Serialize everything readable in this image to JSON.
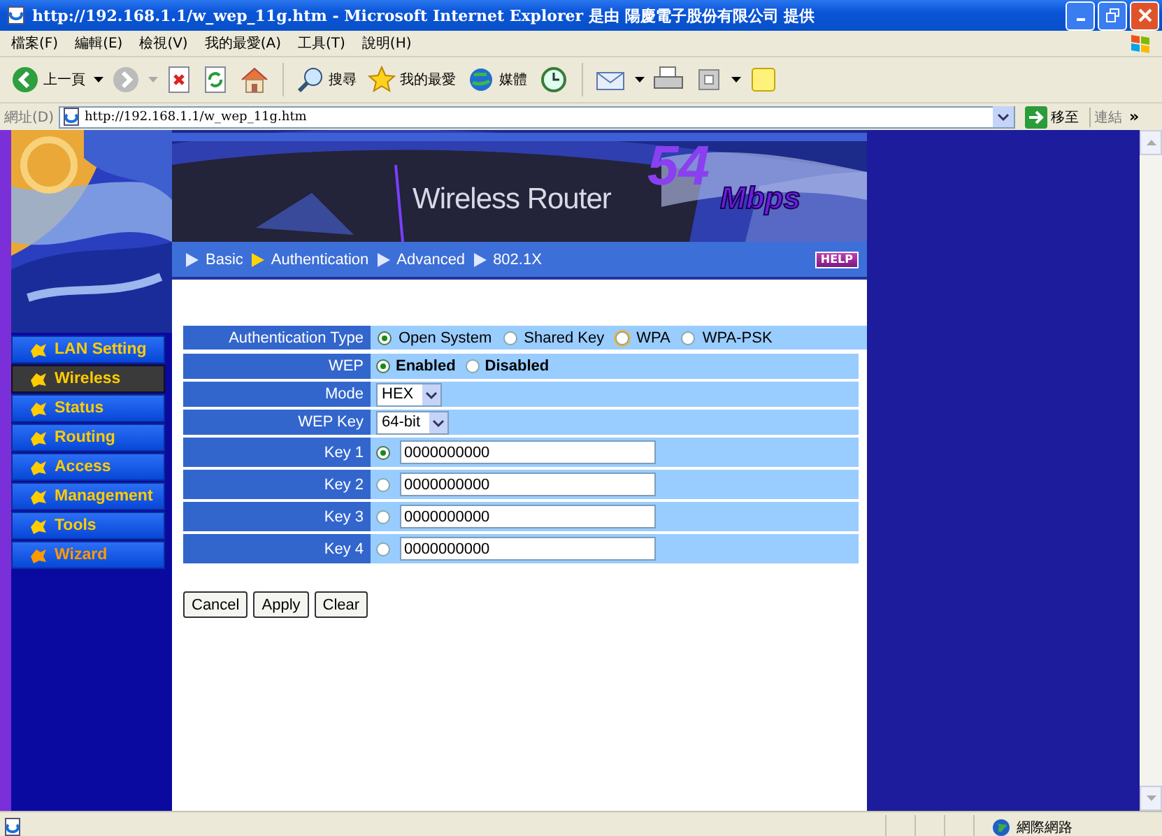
{
  "window": {
    "title": "http://192.168.1.1/w_wep_11g.htm - Microsoft Internet Explorer 是由 陽慶電子股份有限公司 提供"
  },
  "menu": [
    "檔案(F)",
    "編輯(E)",
    "檢視(V)",
    "我的最愛(A)",
    "工具(T)",
    "說明(H)"
  ],
  "toolbar": {
    "back": "上一頁",
    "search": "搜尋",
    "favorites": "我的最愛",
    "media": "媒體"
  },
  "address": {
    "label": "網址(D)",
    "value": "http://192.168.1.1/w_wep_11g.htm",
    "go": "移至",
    "links": "連結",
    "more": "»"
  },
  "sidebar": {
    "items": [
      {
        "label": "LAN Setting",
        "selected": false,
        "color": "#ffcc00"
      },
      {
        "label": "Wireless",
        "selected": true,
        "color": "#ffcc00"
      },
      {
        "label": "Status",
        "selected": false,
        "color": "#ffcc00"
      },
      {
        "label": "Routing",
        "selected": false,
        "color": "#ffcc00"
      },
      {
        "label": "Access",
        "selected": false,
        "color": "#ffcc00"
      },
      {
        "label": "Management",
        "selected": false,
        "color": "#ffcc00"
      },
      {
        "label": "Tools",
        "selected": false,
        "color": "#ffcc00"
      },
      {
        "label": "Wizard",
        "selected": false,
        "color": "#ff9900"
      }
    ]
  },
  "banner": {
    "title": "Wireless Router",
    "speed": "54",
    "unit": "Mbps"
  },
  "tabs": [
    {
      "label": "Basic",
      "selected": false
    },
    {
      "label": "Authentication",
      "selected": true
    },
    {
      "label": "Advanced",
      "selected": false
    },
    {
      "label": "802.1X",
      "selected": false
    }
  ],
  "help": "HELP",
  "form": {
    "auth_type": {
      "label": "Authentication Type",
      "options": [
        {
          "label": "Open System",
          "selected": true,
          "highlighted": false
        },
        {
          "label": "Shared Key",
          "selected": false,
          "highlighted": false
        },
        {
          "label": "WPA",
          "selected": false,
          "highlighted": true
        },
        {
          "label": "WPA-PSK",
          "selected": false,
          "highlighted": false
        }
      ]
    },
    "wep": {
      "label": "WEP",
      "options": [
        {
          "label": "Enabled",
          "selected": true
        },
        {
          "label": "Disabled",
          "selected": false
        }
      ]
    },
    "mode": {
      "label": "Mode",
      "value": "HEX"
    },
    "wep_key": {
      "label": "WEP Key",
      "value": "64-bit"
    },
    "keys": [
      {
        "label": "Key 1",
        "selected": true,
        "value": "0000000000"
      },
      {
        "label": "Key 2",
        "selected": false,
        "value": "0000000000"
      },
      {
        "label": "Key 3",
        "selected": false,
        "value": "0000000000"
      },
      {
        "label": "Key 4",
        "selected": false,
        "value": "0000000000"
      }
    ]
  },
  "buttons": [
    "Cancel",
    "Apply",
    "Clear"
  ],
  "status_bar": {
    "zone": "網際網路"
  }
}
